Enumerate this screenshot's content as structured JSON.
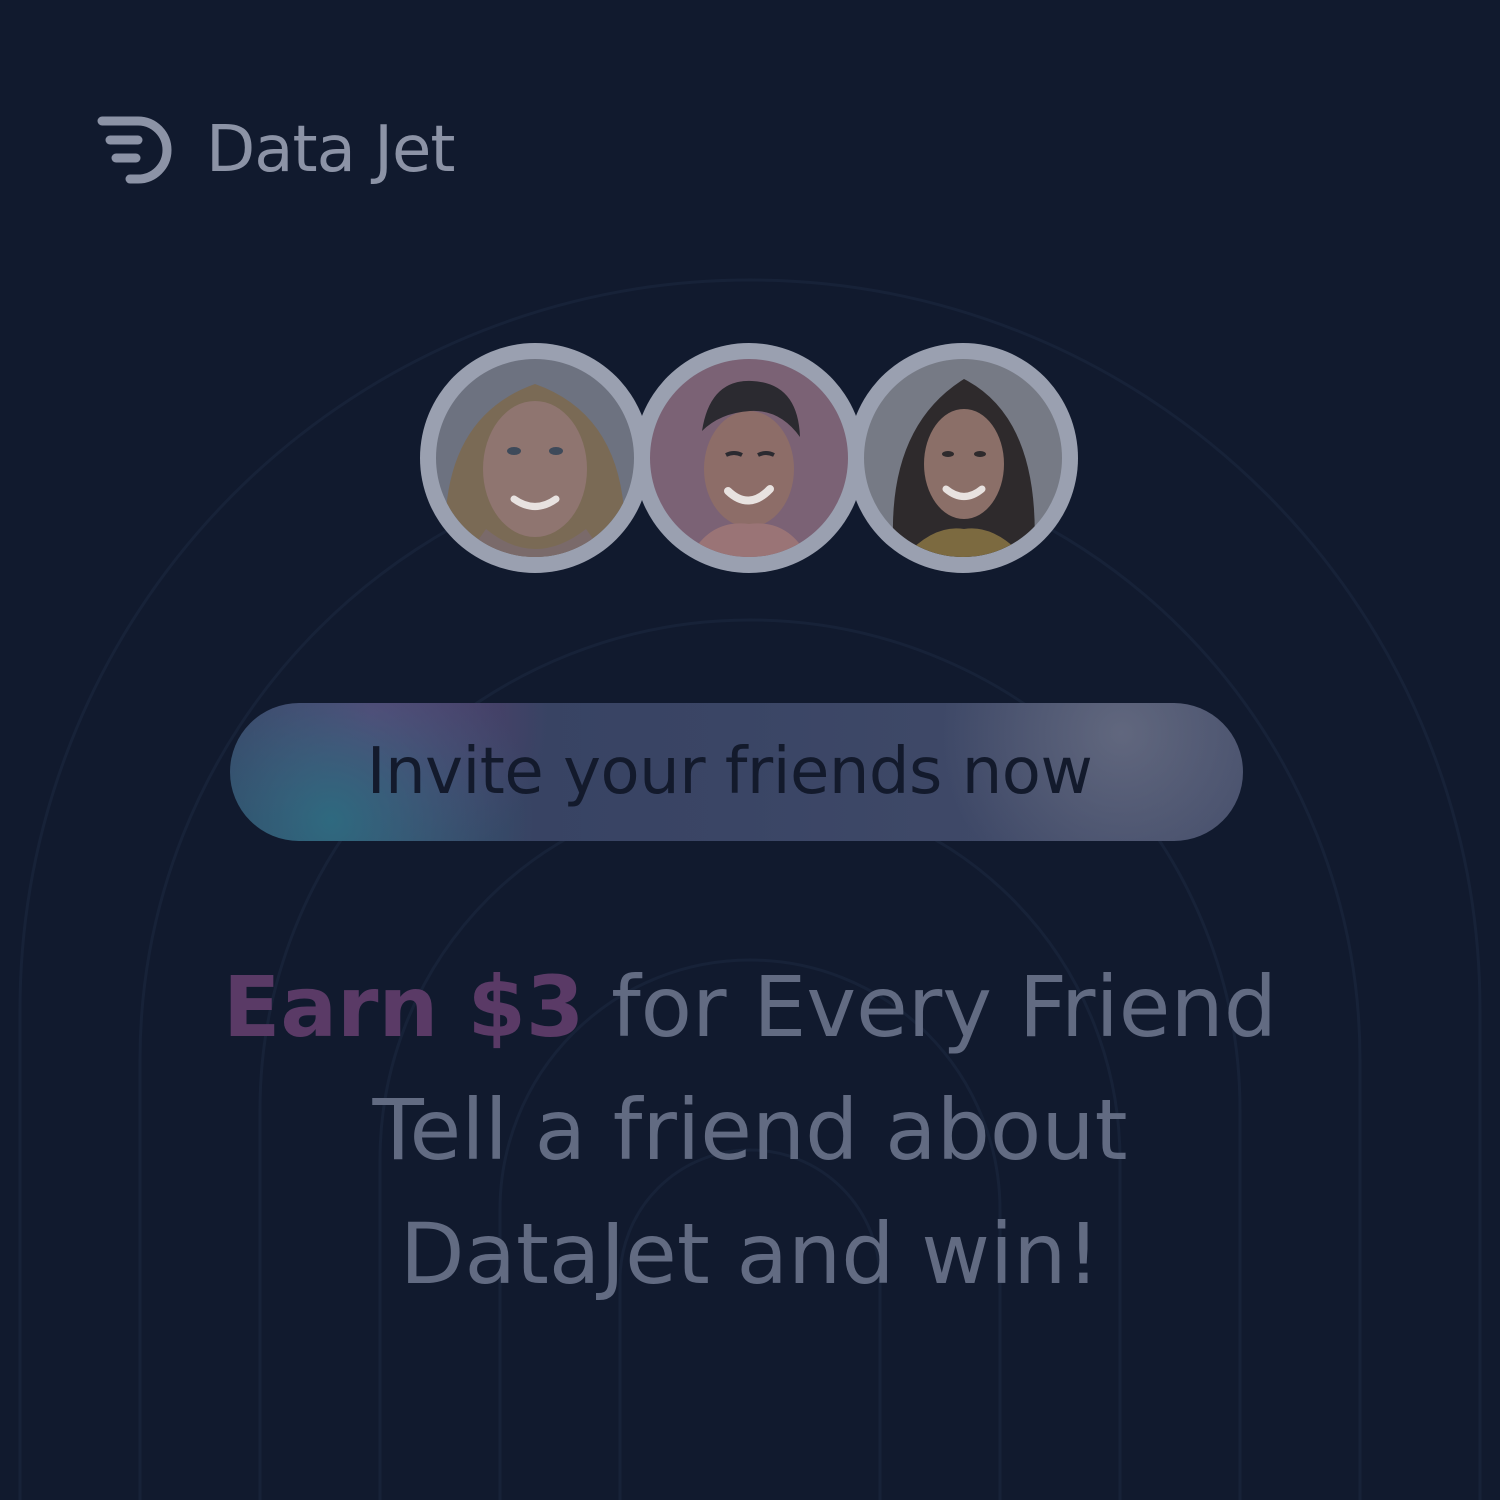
{
  "brand": {
    "name": "Data Jet",
    "icon": "datajet-logo-icon"
  },
  "avatars": [
    {
      "name": "avatar-woman-blonde"
    },
    {
      "name": "avatar-man-curly-hair"
    },
    {
      "name": "avatar-woman-brunette"
    }
  ],
  "cta": {
    "label": "Invite your friends now"
  },
  "headline": {
    "earn": "Earn $3",
    "rest": " for Every Friend",
    "line2": "Tell a friend about",
    "line3": "DataJet and win!"
  },
  "colors": {
    "background": "#111a2e",
    "accent": "#5a3a66",
    "text": "#626b82"
  }
}
